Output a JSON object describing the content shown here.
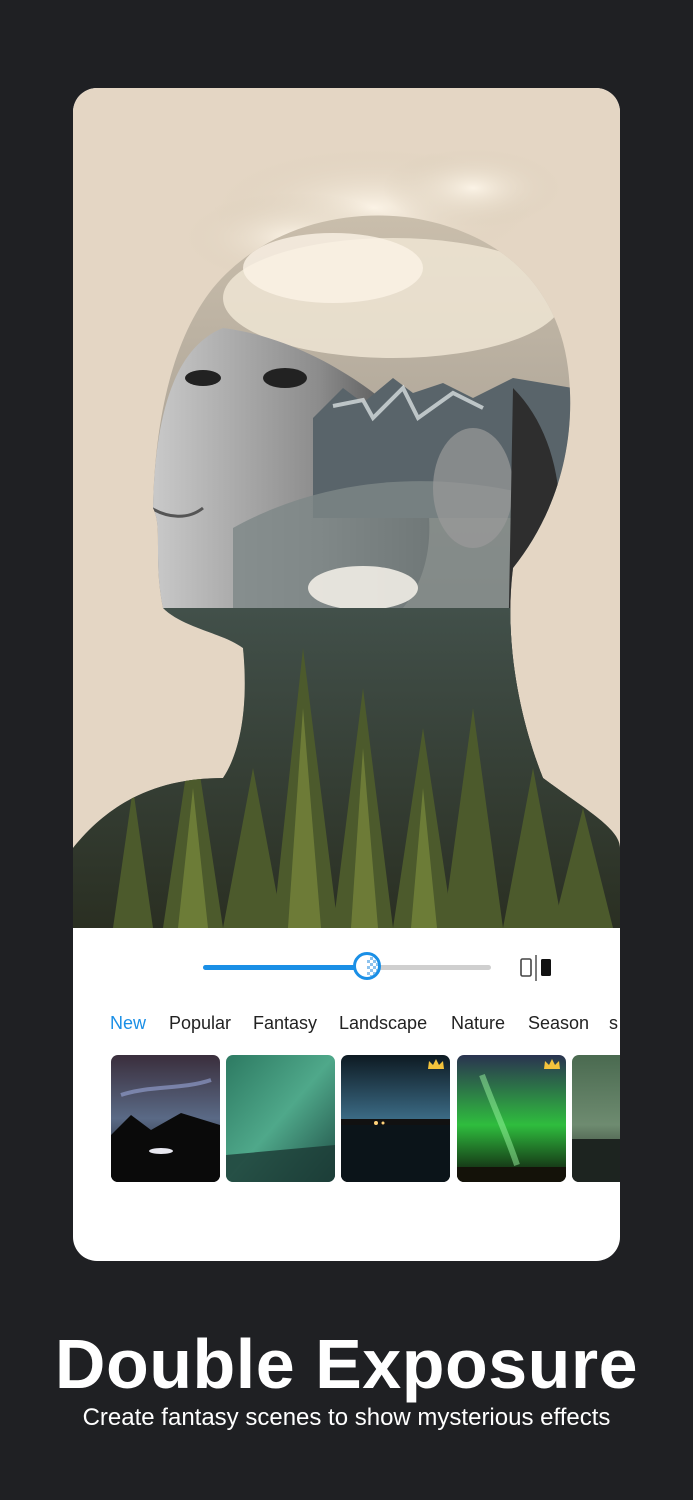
{
  "editor": {
    "blend_slider": {
      "value": 0.57
    },
    "compare_icon": "compare-split-icon"
  },
  "categories": {
    "active": "New",
    "tabs": [
      "New",
      "Popular",
      "Fantasy",
      "Landscape",
      "Nature",
      "Season",
      "s"
    ]
  },
  "filters": [
    {
      "name": "aurora-road",
      "premium": false
    },
    {
      "name": "green-sky",
      "premium": false
    },
    {
      "name": "lake-night",
      "premium": true
    },
    {
      "name": "green-aurora",
      "premium": true
    },
    {
      "name": "aurora-shore",
      "premium": false
    }
  ],
  "promo": {
    "headline": "Double Exposure",
    "subline": "Create fantasy scenes to show mysterious effects"
  },
  "colors": {
    "background": "#1f2023",
    "accent": "#1a8fe6",
    "preview_bg": "#e4d6c4"
  }
}
